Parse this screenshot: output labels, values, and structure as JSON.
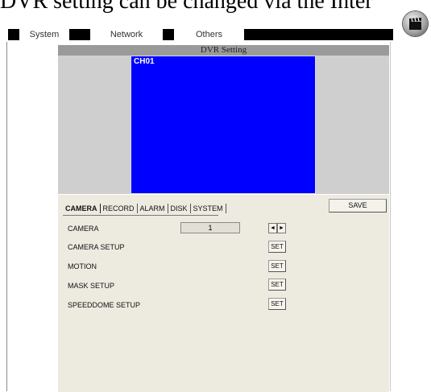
{
  "caption": "DVR setting can be changed via the Inter",
  "tabs": [
    "System",
    "Network",
    "Others"
  ],
  "panel": {
    "title": "DVR Setting",
    "channel_label": "CH01"
  },
  "settings": {
    "tabs": [
      "CAMERA",
      "RECORD",
      "ALARM",
      "DISK",
      "SYSTEM"
    ],
    "save_label": "SAVE",
    "camera_label": "CAMERA",
    "camera_value": "1",
    "arrow_left": "◄",
    "arrow_right": "►",
    "rows": [
      {
        "label": "CAMERA SETUP",
        "button": "SET"
      },
      {
        "label": "MOTION",
        "button": "SET"
      },
      {
        "label": "MASK SETUP",
        "button": "SET"
      },
      {
        "label": "SPEEDDOME SETUP",
        "button": "SET"
      }
    ]
  },
  "colors": {
    "video_background": "#0000ff",
    "settings_background": "#edeae0",
    "panel_background": "#cfcfcf"
  },
  "icons": {
    "app": "clapperboard-icon"
  }
}
